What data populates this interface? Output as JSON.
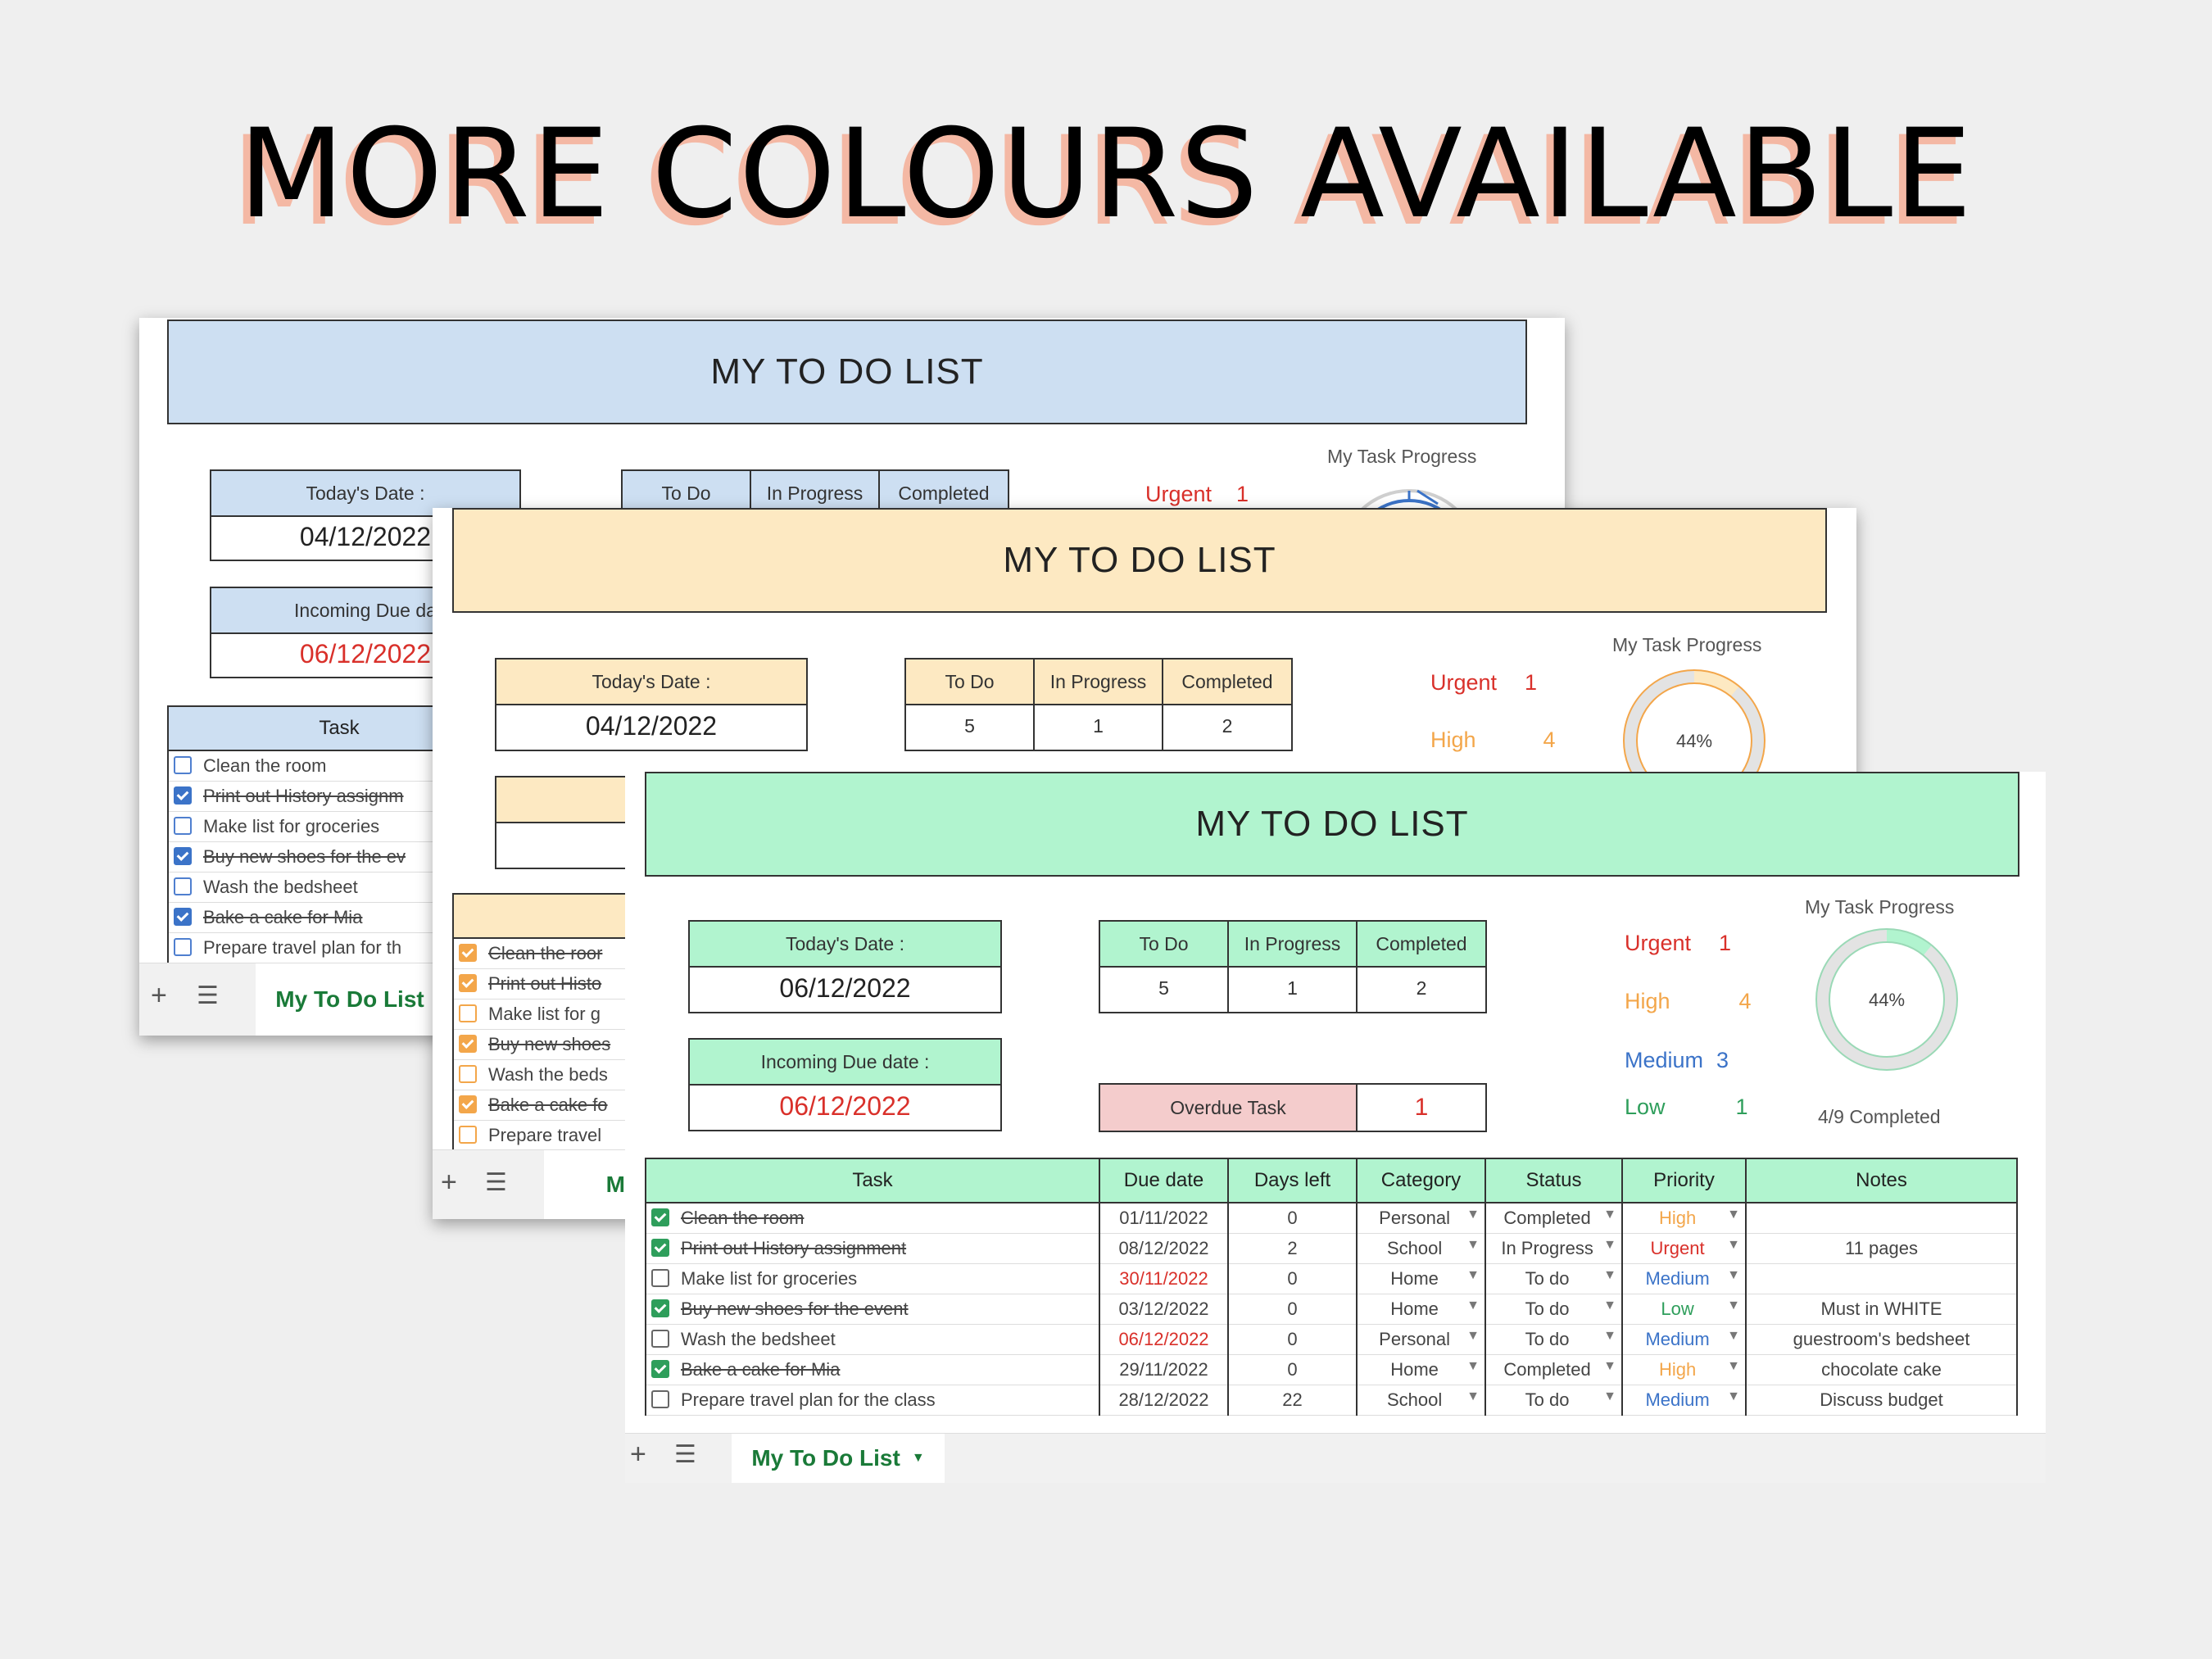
{
  "headline": "MORE COLOURS AVAILABLE",
  "colors": {
    "blue": "#cddff2",
    "yellow": "#fde9c2",
    "green": "#b1f4cf",
    "urgent": "#d9302a",
    "high": "#f3a64a",
    "medium": "#3b73c8",
    "low": "#2e9e5b",
    "overdue": "#f4cccc"
  },
  "blue_sheet": {
    "title": "MY TO DO LIST",
    "today_label": "Today's Date :",
    "today_value": "04/12/2022",
    "due_label": "Incoming Due da",
    "due_value": "06/12/2022",
    "stats_headers": [
      "To Do",
      "In Progress",
      "Completed"
    ],
    "urgent_label": "Urgent",
    "urgent_count": "1",
    "progress_title": "My Task Progress",
    "task_header": "Task",
    "tasks": [
      "Clean the room",
      "Print out History assignm",
      "Make list for groceries",
      "Buy new shoes for the ev",
      "Wash the bedsheet",
      "Bake a cake for Mia",
      "Prepare travel plan for th"
    ],
    "tab": "My To Do List"
  },
  "yellow_sheet": {
    "title": "MY TO DO LIST",
    "today_label": "Today's Date :",
    "today_value": "04/12/2022",
    "due_label": "Incomi",
    "due_value": "06/",
    "stats_headers": [
      "To Do",
      "In Progress",
      "Completed"
    ],
    "stats_values": [
      "5",
      "1",
      "2"
    ],
    "urgent_label": "Urgent",
    "urgent_count": "1",
    "high_label": "High",
    "high_count": "4",
    "progress_title": "My Task Progress",
    "progress_pct": "44%",
    "tasks": [
      "Clean the roor",
      "Print out Histo",
      "Make list for g",
      "Buy new shoes",
      "Wash the beds",
      "Bake a cake fo",
      "Prepare travel"
    ],
    "tab": "My To"
  },
  "green_sheet": {
    "title": "MY TO DO LIST",
    "today_label": "Today's Date :",
    "today_value": "06/12/2022",
    "due_label": "Incoming Due date :",
    "due_value": "06/12/2022",
    "stats_headers": [
      "To Do",
      "In Progress",
      "Completed"
    ],
    "stats_values": [
      "5",
      "1",
      "2"
    ],
    "overdue_label": "Overdue Task",
    "overdue_value": "1",
    "priority_counts": [
      {
        "label": "Urgent",
        "count": "1"
      },
      {
        "label": "High",
        "count": "4"
      },
      {
        "label": "Medium",
        "count": "3"
      },
      {
        "label": "Low",
        "count": "1"
      }
    ],
    "progress_title": "My Task Progress",
    "progress_pct": "44%",
    "progress_fraction": 0.44,
    "completed_text": "4/9 Completed",
    "table_headers": [
      "Task",
      "Due date",
      "Days left",
      "Category",
      "Status",
      "Priority",
      "Notes"
    ],
    "rows": [
      {
        "task": "Clean the room",
        "due": "01/11/2022",
        "days": "0",
        "category": "Personal",
        "status": "Completed",
        "priority": "High",
        "notes": ""
      },
      {
        "task": "Print out History assignment",
        "due": "08/12/2022",
        "days": "2",
        "category": "School",
        "status": "In Progress",
        "priority": "Urgent",
        "notes": "11 pages"
      },
      {
        "task": "Make list for groceries",
        "due": "30/11/2022",
        "days": "0",
        "category": "Home",
        "status": "To do",
        "priority": "Medium",
        "notes": ""
      },
      {
        "task": "Buy new shoes for the event",
        "due": "03/12/2022",
        "days": "0",
        "category": "Home",
        "status": "To do",
        "priority": "Low",
        "notes": "Must in WHITE"
      },
      {
        "task": "Wash the bedsheet",
        "due": "06/12/2022",
        "days": "0",
        "category": "Personal",
        "status": "To do",
        "priority": "Medium",
        "notes": "guestroom's bedsheet"
      },
      {
        "task": "Bake a cake for Mia",
        "due": "29/11/2022",
        "days": "0",
        "category": "Home",
        "status": "Completed",
        "priority": "High",
        "notes": "chocolate cake"
      },
      {
        "task": "Prepare travel plan for the class",
        "due": "28/12/2022",
        "days": "22",
        "category": "School",
        "status": "To do",
        "priority": "Medium",
        "notes": "Discuss budget"
      }
    ],
    "tab": "My To Do List"
  }
}
